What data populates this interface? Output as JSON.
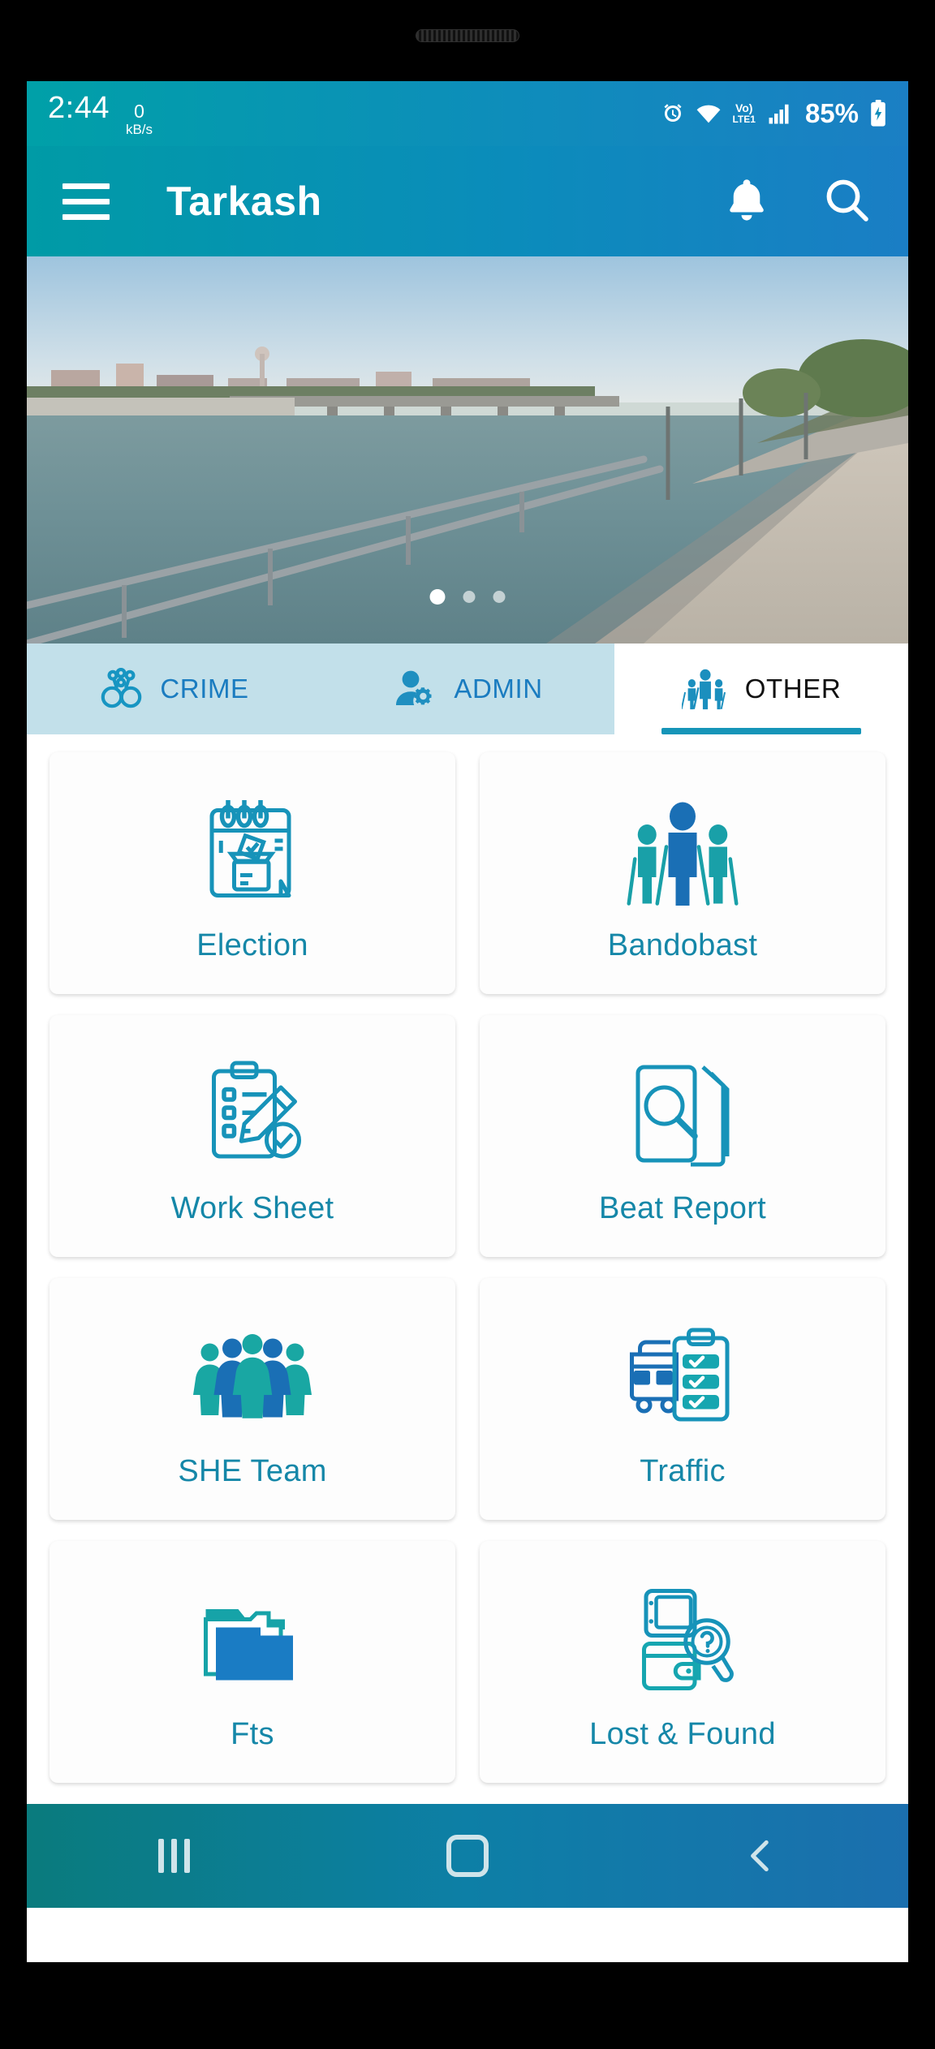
{
  "status_bar": {
    "time": "2:44",
    "net_speed_value": "0",
    "net_speed_unit": "kB/s",
    "alarm_icon": "alarm-clock-icon",
    "wifi_icon": "wifi-icon",
    "volte_top": "Vo)",
    "volte_bottom": "LTE1",
    "signal_icon": "signal-bars-icon",
    "battery_percent": "85%",
    "battery_icon": "battery-charging-icon"
  },
  "app_bar": {
    "menu_icon": "hamburger-menu-icon",
    "title": "Tarkash",
    "notification_icon": "bell-icon",
    "search_icon": "search-icon"
  },
  "banner": {
    "description": "riverfront-promenade-photo",
    "slide_count": 3,
    "active_slide": 3
  },
  "tabs": [
    {
      "label": "CRIME",
      "icon": "handcuffs-icon",
      "active": false
    },
    {
      "label": "ADMIN",
      "icon": "person-gear-icon",
      "active": false
    },
    {
      "label": "OTHER",
      "icon": "police-group-icon",
      "active": true
    }
  ],
  "tiles": [
    {
      "label": "Election",
      "icon": "ballot-box-notepad-icon"
    },
    {
      "label": "Bandobast",
      "icon": "police-group-icon"
    },
    {
      "label": "Work Sheet",
      "icon": "clipboard-pencil-icon"
    },
    {
      "label": "Beat Report",
      "icon": "document-magnifier-icon"
    },
    {
      "label": "SHE Team",
      "icon": "women-team-icon"
    },
    {
      "label": "Traffic",
      "icon": "bus-checklist-icon"
    },
    {
      "label": "Fts",
      "icon": "folder-icon"
    },
    {
      "label": "Lost & Found",
      "icon": "wallet-phone-question-icon"
    }
  ],
  "nav_bar": {
    "recents_label": "recents-button",
    "home_label": "home-button",
    "back_label": "back-button"
  },
  "colors": {
    "accent_teal": "#1587a8",
    "header_gradient_start": "#009ba6",
    "header_gradient_end": "#1a7ec5",
    "tab_inactive_bg": "#c2e0ea",
    "tab_active_text": "#111111",
    "tab_link_blue": "#1a7cc0"
  }
}
